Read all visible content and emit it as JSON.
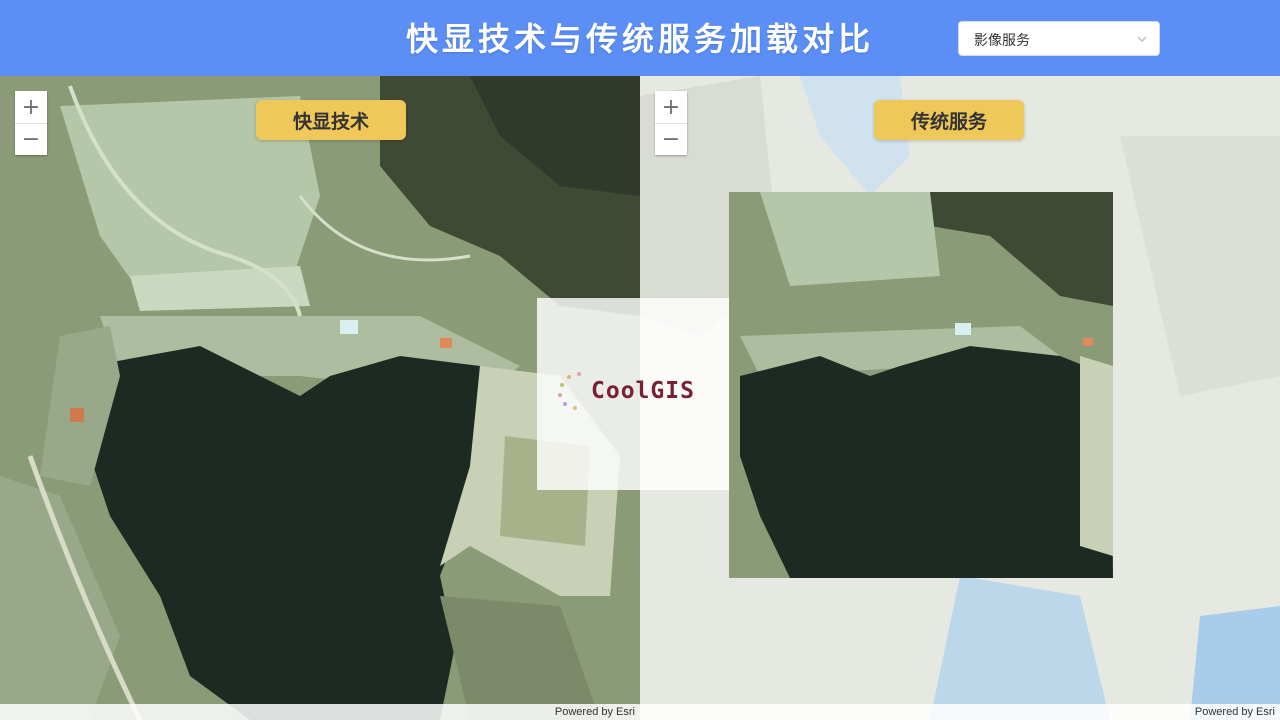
{
  "header": {
    "title": "快显技术与传统服务加载对比",
    "layer_select": {
      "value": "影像服务"
    }
  },
  "left_map": {
    "badge": "快显技术",
    "zoom_in": "+",
    "zoom_out": "−",
    "attribution": "Powered by Esri"
  },
  "right_map": {
    "badge": "传统服务",
    "zoom_in": "+",
    "zoom_out": "−",
    "attribution": "Powered by Esri"
  },
  "watermark": {
    "text": "CoolGIS"
  },
  "colors": {
    "header_bg": "#5b8ff5",
    "badge_bg": "#f0c85a",
    "water": "#1d2a22",
    "terrain": "#8fa07c",
    "watermark_text": "#7a2034"
  }
}
